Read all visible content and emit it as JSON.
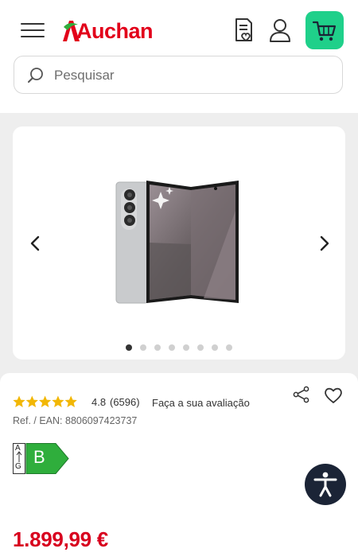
{
  "header": {
    "logo_text": "Auchan",
    "brand_color": "#e2001a",
    "cart_color": "#1fd08a",
    "icons": [
      "menu-icon",
      "shopping-list-icon",
      "user-icon",
      "cart-icon"
    ]
  },
  "search": {
    "placeholder": "Pesquisar"
  },
  "gallery": {
    "dot_count": 8,
    "active_index": 0
  },
  "product": {
    "rating": "4.8",
    "rating_value": 4.8,
    "review_count": "(6596)",
    "review_link": "Faça a sua avaliação",
    "ref": "Ref. / EAN: 8806097423737",
    "energy": {
      "scale_top": "A",
      "scale_bottom": "G",
      "class": "B",
      "color": "#2fae3c"
    },
    "price": "1.899,99 €",
    "price_color": "#d8001e"
  }
}
